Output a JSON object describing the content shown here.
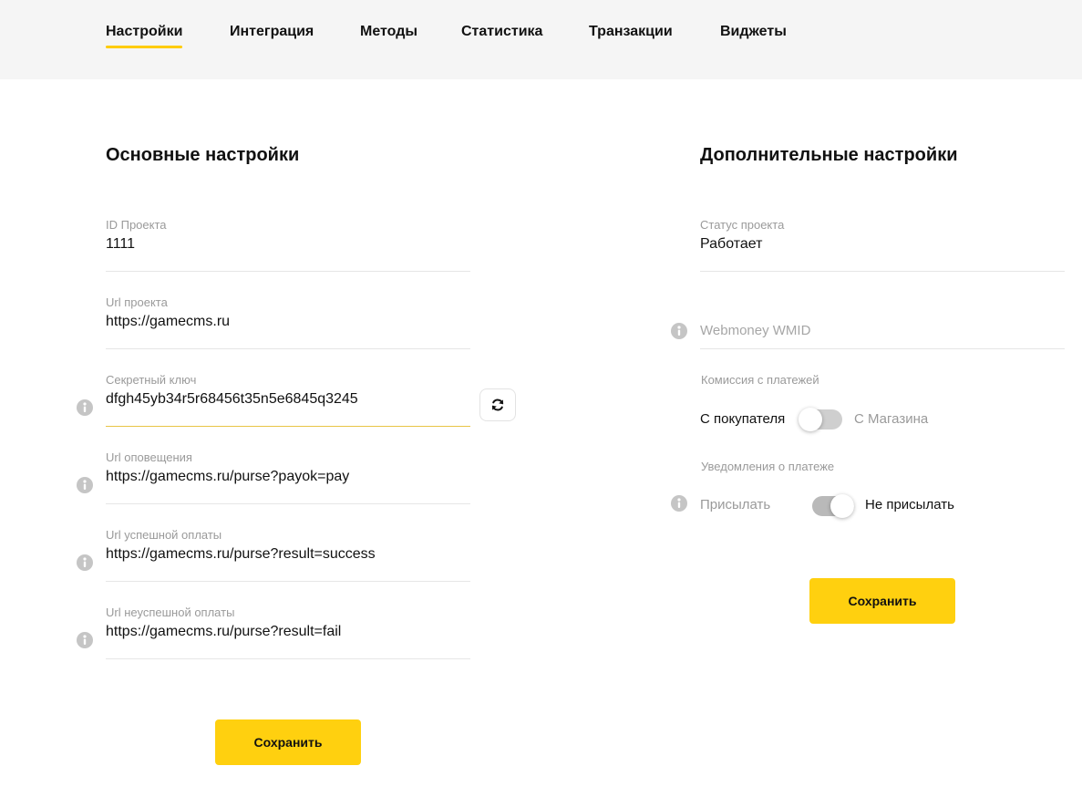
{
  "nav": {
    "tabs": [
      {
        "label": "Настройки",
        "active": true
      },
      {
        "label": "Интеграция"
      },
      {
        "label": "Методы"
      },
      {
        "label": "Статистика"
      },
      {
        "label": "Транзакции"
      },
      {
        "label": "Виджеты"
      }
    ]
  },
  "main": {
    "title": "Основные настройки",
    "fields": [
      {
        "label": "ID Проекта",
        "value": "1111"
      },
      {
        "label": "Url проекта",
        "value": "https://gamecms.ru"
      },
      {
        "label": "Секретный ключ",
        "value": "dfgh45yb34r5r68456t35n5e6845q3245",
        "focused": true
      },
      {
        "label": "Url оповещения",
        "value": "https://gamecms.ru/purse?payok=pay"
      },
      {
        "label": "Url успешной оплаты",
        "value": "https://gamecms.ru/purse?result=success"
      },
      {
        "label": "Url неуспешной оплаты",
        "value": "https://gamecms.ru/purse?result=fail"
      }
    ],
    "save_label": "Сохранить"
  },
  "extra": {
    "title": "Дополнительные настройки",
    "status": {
      "label": "Статус проекта",
      "value": "Работает"
    },
    "wmid": {
      "placeholder": "Webmoney WMID"
    },
    "commission": {
      "label": "Комиссия с платежей",
      "left": "С покупателя",
      "right": "С Магазина",
      "selected": "С покупателя"
    },
    "notify": {
      "label": "Уведомления о платеже",
      "left": "Присылать",
      "right": "Не присылать",
      "selected": "Не присылать"
    },
    "save_label": "Сохранить"
  },
  "colors": {
    "accent": "#ffd00f",
    "tabs_bg": "#f5f5f5",
    "muted_text": "#9a9a9a",
    "info_icon": "#c5c5c5",
    "toggle_track": "#c9c9c9"
  },
  "icons": {
    "info": "info-icon",
    "refresh": "refresh-icon"
  }
}
